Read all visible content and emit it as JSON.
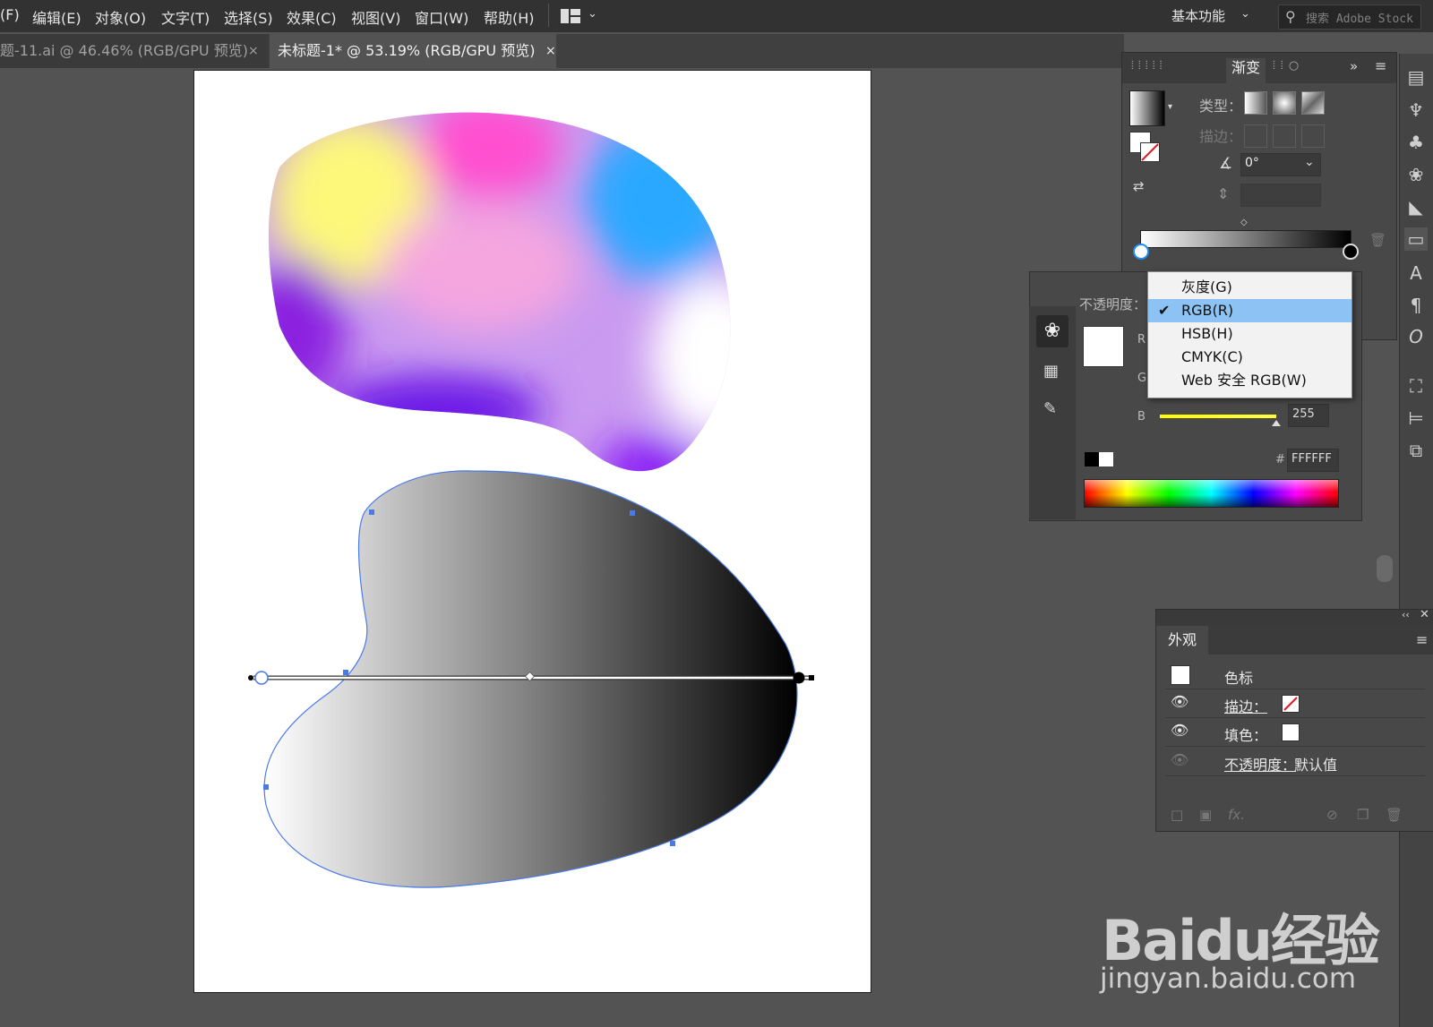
{
  "menubar": {
    "items": [
      "(F)",
      "编辑(E)",
      "对象(O)",
      "文字(T)",
      "选择(S)",
      "效果(C)",
      "视图(V)",
      "窗口(W)",
      "帮助(H)"
    ],
    "workspace": "基本功能",
    "search_placeholder": "搜索 Adobe Stock"
  },
  "tabs": [
    {
      "label": "题-11.ai @ 46.46% (RGB/GPU 预览)",
      "close": "×"
    },
    {
      "label": "未标题-1* @ 53.19% (RGB/GPU 预览)",
      "close": "×"
    }
  ],
  "gradient_panel": {
    "title": "渐变",
    "type_label": "类型：",
    "stroke_label": "描边：",
    "angle_value": "0°",
    "expand": "»"
  },
  "color_panel": {
    "opacity_label": "不透明度：",
    "r_label": "R",
    "g_label": "G",
    "b_label": "B",
    "b_value": "255",
    "b_fraction": 1.0,
    "hex_prefix": "#",
    "hex_value": "FFFFFF"
  },
  "dropdown": {
    "items": [
      "灰度(G)",
      "RGB(R)",
      "HSB(H)",
      "CMYK(C)",
      "Web 安全 RGB(W)"
    ],
    "selected_index": 1
  },
  "appearance_panel": {
    "title": "外观",
    "rows": [
      {
        "label": "色标"
      },
      {
        "label": "描边："
      },
      {
        "label": "填色："
      },
      {
        "label": "不透明度：",
        "value": "默认值"
      }
    ]
  },
  "watermark": {
    "brand": "Baidu经验",
    "url": "jingyan.baidu.com"
  },
  "colors": {
    "accent": "#1e8cf0",
    "selection": "#8cc3f4",
    "path_stroke": "#4a7ae8"
  }
}
